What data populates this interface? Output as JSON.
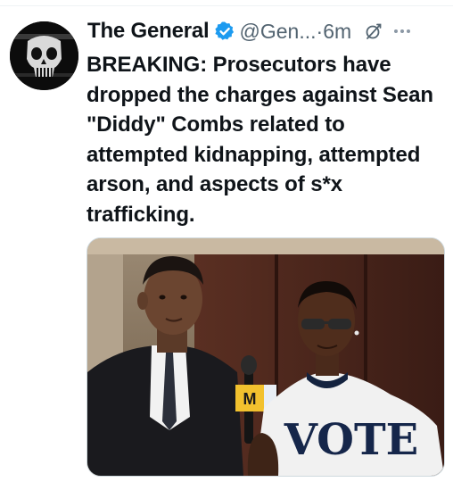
{
  "tweet": {
    "author_name": "The General",
    "handle": "@Gen...",
    "separator": "·",
    "time": "6m",
    "text": "BREAKING: Prosecutors have dropped the charges against Sean \"Diddy\" Combs related to attempted kidnapping, attempted arson, and aspects of s*x trafficking.",
    "media": {
      "shirt_text": "VOTE",
      "mic_flag_letter": "M"
    }
  },
  "icons": {
    "avatar": "punisher-skull-avatar",
    "verified": "verified-badge-icon",
    "grok": "grok-icon",
    "more": "more-options-icon"
  },
  "colors": {
    "verified": "#1d9bf0",
    "secondary_text": "#536471",
    "primary_text": "#0f1419"
  }
}
